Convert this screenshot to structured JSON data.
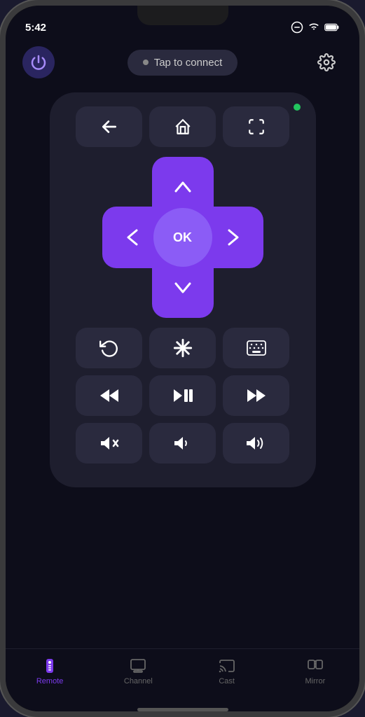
{
  "status": {
    "time": "5:42",
    "icons": [
      "minus-circle",
      "wifi-full",
      "battery-full"
    ]
  },
  "header": {
    "power_label": "power",
    "connect_text": "Tap to connect",
    "settings_label": "settings"
  },
  "remote": {
    "green_dot_visible": true,
    "nav_buttons": [
      {
        "id": "back",
        "icon": "←",
        "label": "back"
      },
      {
        "id": "home",
        "icon": "⌂",
        "label": "home"
      },
      {
        "id": "fullscreen",
        "icon": "⛶",
        "label": "fullscreen"
      }
    ],
    "dpad": {
      "up": "∧",
      "down": "∨",
      "left": "<",
      "right": ">",
      "ok": "OK"
    },
    "control_row1": [
      {
        "id": "replay",
        "icon": "↺",
        "label": "replay"
      },
      {
        "id": "asterisk",
        "icon": "✱",
        "label": "options"
      },
      {
        "id": "keyboard",
        "icon": "⌨",
        "label": "keyboard"
      }
    ],
    "control_row2": [
      {
        "id": "rewind",
        "icon": "⏪",
        "label": "rewind"
      },
      {
        "id": "playpause",
        "icon": "⏯",
        "label": "play-pause"
      },
      {
        "id": "forward",
        "icon": "⏩",
        "label": "fast-forward"
      }
    ],
    "control_row3": [
      {
        "id": "mute",
        "icon": "🔇",
        "label": "mute"
      },
      {
        "id": "vol-down",
        "icon": "🔉",
        "label": "volume-down"
      },
      {
        "id": "vol-up",
        "icon": "🔊",
        "label": "volume-up"
      }
    ]
  },
  "tabs": [
    {
      "id": "remote",
      "label": "Remote",
      "icon": "remote",
      "active": true
    },
    {
      "id": "channel",
      "label": "Channel",
      "icon": "channel",
      "active": false
    },
    {
      "id": "cast",
      "label": "Cast",
      "icon": "cast",
      "active": false
    },
    {
      "id": "mirror",
      "label": "Mirror",
      "icon": "mirror",
      "active": false
    }
  ],
  "colors": {
    "accent": "#7c3aed",
    "accent_light": "#8b5cf6",
    "bg_dark": "#0d0d1a",
    "bg_panel": "#1e1e2e",
    "bg_button": "#2a2a3e"
  }
}
